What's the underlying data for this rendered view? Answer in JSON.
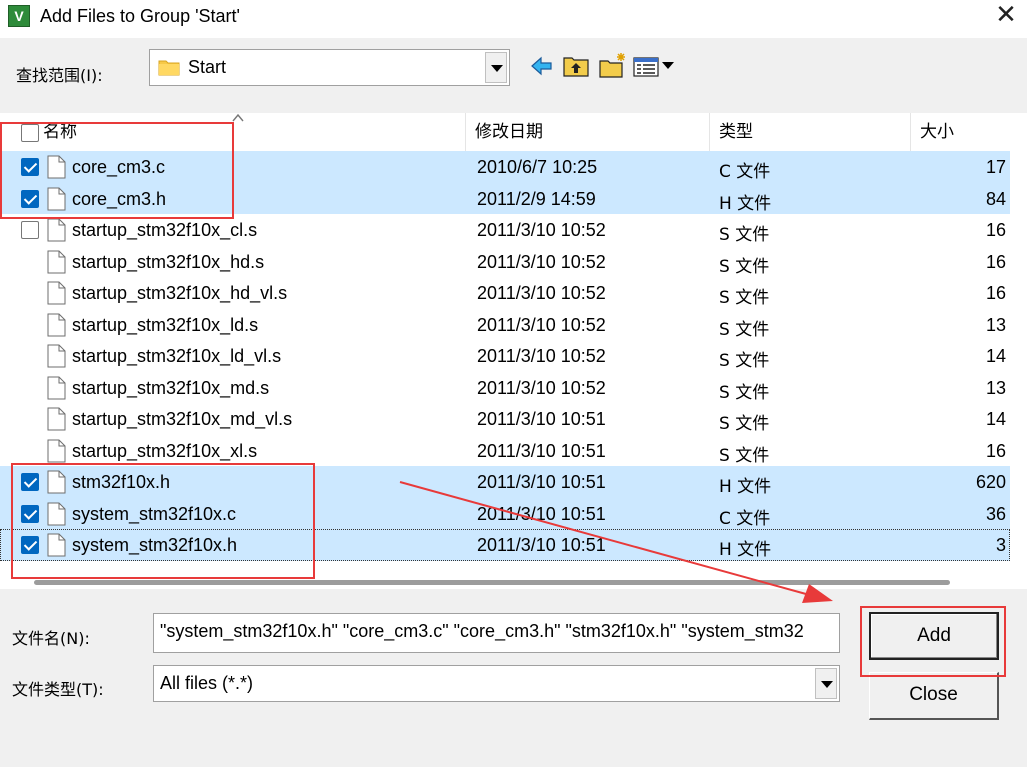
{
  "window": {
    "title": "Add Files to Group 'Start'",
    "app_icon_text": "V",
    "close_glyph": "✕"
  },
  "lookin": {
    "label": "查找范围(I):",
    "value": "Start"
  },
  "toolbar": {
    "icons": [
      "back-arrow-icon",
      "up-folder-icon",
      "new-folder-icon",
      "view-menu-icon"
    ]
  },
  "columns": {
    "name": "名称",
    "modified": "修改日期",
    "type": "类型",
    "size": "大小"
  },
  "files": [
    {
      "name": "core_cm3.c",
      "date": "2010/6/7 10:25",
      "type": "C 文件",
      "size": "17",
      "checked": true,
      "selected": true
    },
    {
      "name": "core_cm3.h",
      "date": "2011/2/9 14:59",
      "type": "H 文件",
      "size": "84",
      "checked": true,
      "selected": true
    },
    {
      "name": "startup_stm32f10x_cl.s",
      "date": "2011/3/10 10:52",
      "type": "S 文件",
      "size": "16",
      "checked": false,
      "selected": false,
      "hover": true
    },
    {
      "name": "startup_stm32f10x_hd.s",
      "date": "2011/3/10 10:52",
      "type": "S 文件",
      "size": "16",
      "checked": false,
      "selected": false
    },
    {
      "name": "startup_stm32f10x_hd_vl.s",
      "date": "2011/3/10 10:52",
      "type": "S 文件",
      "size": "16",
      "checked": false,
      "selected": false
    },
    {
      "name": "startup_stm32f10x_ld.s",
      "date": "2011/3/10 10:52",
      "type": "S 文件",
      "size": "13",
      "checked": false,
      "selected": false
    },
    {
      "name": "startup_stm32f10x_ld_vl.s",
      "date": "2011/3/10 10:52",
      "type": "S 文件",
      "size": "14",
      "checked": false,
      "selected": false
    },
    {
      "name": "startup_stm32f10x_md.s",
      "date": "2011/3/10 10:52",
      "type": "S 文件",
      "size": "13",
      "checked": false,
      "selected": false
    },
    {
      "name": "startup_stm32f10x_md_vl.s",
      "date": "2011/3/10 10:51",
      "type": "S 文件",
      "size": "14",
      "checked": false,
      "selected": false
    },
    {
      "name": "startup_stm32f10x_xl.s",
      "date": "2011/3/10 10:51",
      "type": "S 文件",
      "size": "16",
      "checked": false,
      "selected": false
    },
    {
      "name": "stm32f10x.h",
      "date": "2011/3/10 10:51",
      "type": "H 文件",
      "size": "620",
      "checked": true,
      "selected": true
    },
    {
      "name": "system_stm32f10x.c",
      "date": "2011/3/10 10:51",
      "type": "C 文件",
      "size": "36",
      "checked": true,
      "selected": true
    },
    {
      "name": "system_stm32f10x.h",
      "date": "2011/3/10 10:51",
      "type": "H 文件",
      "size": "3",
      "checked": true,
      "selected": true,
      "focused": true
    }
  ],
  "filename": {
    "label": "文件名(N):",
    "value": "\"system_stm32f10x.h\" \"core_cm3.c\" \"core_cm3.h\" \"stm32f10x.h\" \"system_stm32"
  },
  "filetype": {
    "label": "文件类型(T):",
    "value": "All files (*.*)"
  },
  "buttons": {
    "add": "Add",
    "close": "Close"
  },
  "colors": {
    "selection": "#cce8ff",
    "checkbox_on": "#0067c0",
    "annotation": "#e83a3a"
  }
}
